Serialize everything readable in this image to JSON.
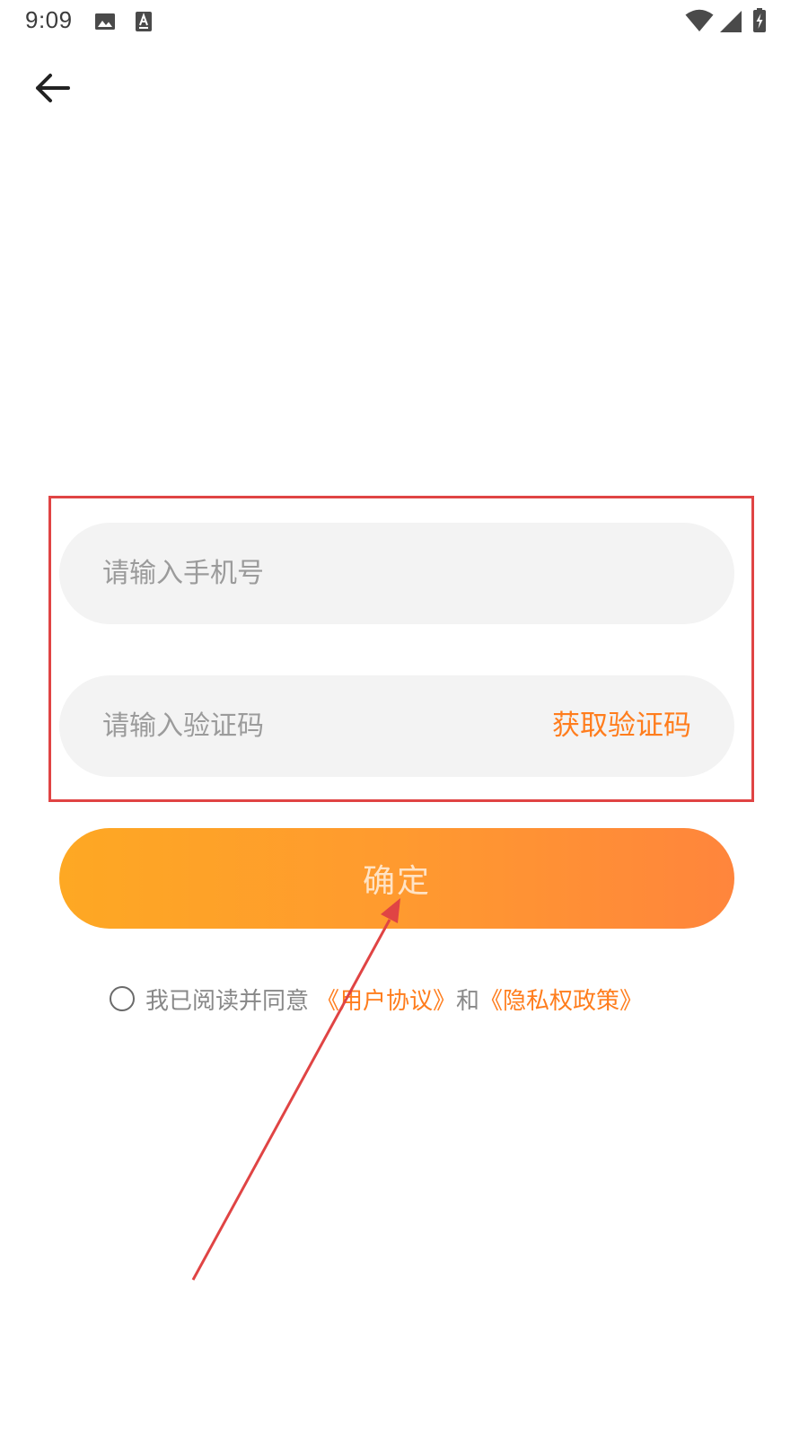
{
  "status_bar": {
    "time": "9:09",
    "icons": [
      "image-icon",
      "a-notification-icon",
      "wifi-icon",
      "signal-icon",
      "battery-charging-icon"
    ]
  },
  "nav": {
    "back_icon": "back-arrow-icon"
  },
  "form": {
    "phone_placeholder": "请输入手机号",
    "phone_value": "",
    "code_placeholder": "请输入验证码",
    "code_value": "",
    "get_code_label": "获取验证码",
    "confirm_label": "确定"
  },
  "agreement": {
    "checked": false,
    "prefix": "我已阅读并同意",
    "user_agreement": "《用户协议》",
    "and": "和",
    "privacy_policy": "《隐私权政策》"
  },
  "colors": {
    "accent": "#ff7d1d",
    "button_gradient_start": "#fea823",
    "button_gradient_end": "#ff853c",
    "input_background": "#f3f3f3",
    "annotation": "#e04444"
  }
}
